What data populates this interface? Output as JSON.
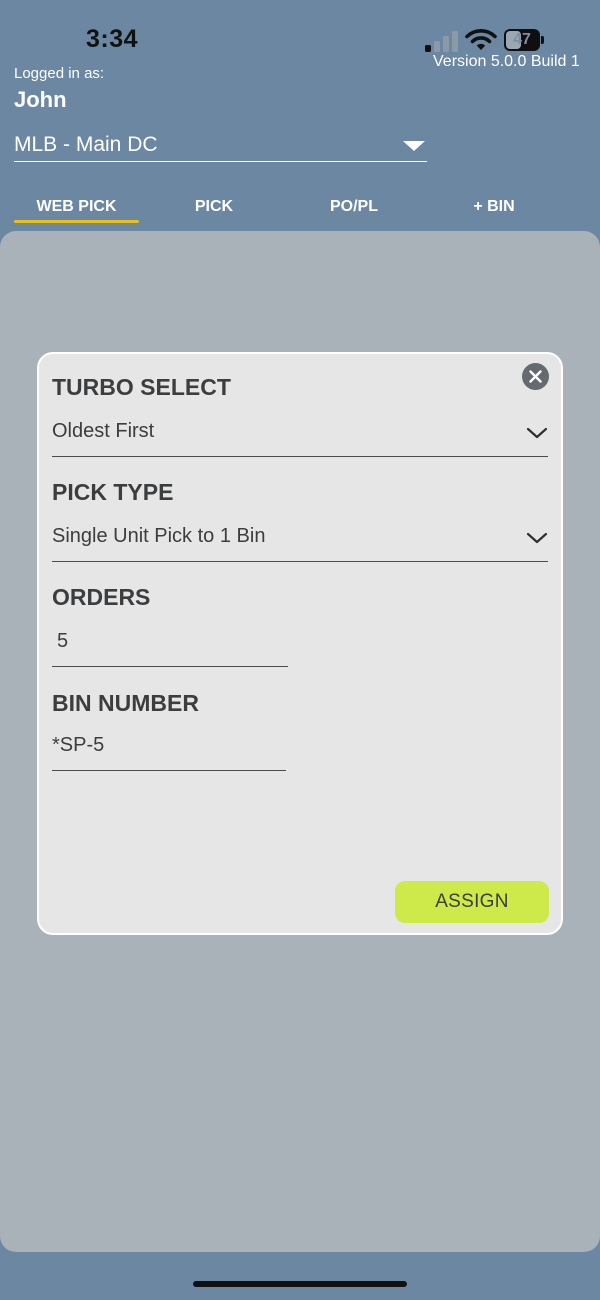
{
  "status_bar": {
    "time": "3:34",
    "battery_level": "47",
    "battery_fraction": 0.47,
    "signal_bars_active": 1,
    "signal_bars_total": 4
  },
  "header": {
    "version": "Version 5.0.0 Build 1",
    "logged_in_label": "Logged in as:",
    "user_name": "John",
    "location_value": "MLB - Main DC"
  },
  "tabs": [
    {
      "label": "WEB PICK",
      "active": true
    },
    {
      "label": "PICK",
      "active": false
    },
    {
      "label": "PO/PL",
      "active": false
    },
    {
      "label": "+ BIN",
      "active": false
    }
  ],
  "modal": {
    "turbo_select": {
      "label": "TURBO SELECT",
      "value": "Oldest First"
    },
    "pick_type": {
      "label": "PICK TYPE",
      "value": "Single Unit Pick to 1 Bin"
    },
    "orders": {
      "label": "ORDERS",
      "value": "5"
    },
    "bin_number": {
      "label": "BIN NUMBER",
      "value": "*SP-5"
    },
    "assign_label": "ASSIGN"
  },
  "colors": {
    "header_bg": "#6b87a2",
    "panel_bg": "#a9b1b9",
    "modal_bg": "#e6e6e6",
    "tab_accent": "#e8c21b",
    "assign_button": "#cee94a"
  },
  "icons": [
    "signal-icon",
    "wifi-icon",
    "battery-icon",
    "dropdown-caret-icon",
    "close-icon",
    "chevron-down-icon"
  ]
}
